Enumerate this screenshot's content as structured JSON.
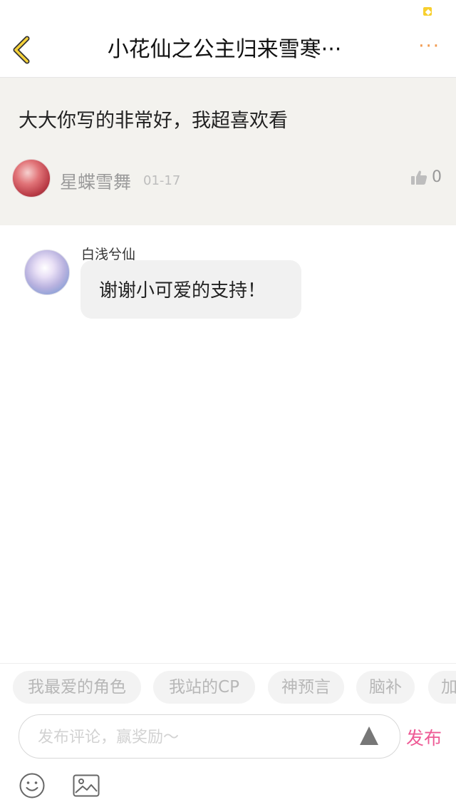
{
  "header": {
    "title": "小花仙之公主归来雪寒···",
    "back_icon": "chevron-left-icon",
    "more_label": "···",
    "accent_color": "#f7cf2e"
  },
  "post": {
    "text": "大大你写的非常好，我超喜欢看",
    "username": "星蝶雪舞",
    "date": "01-17",
    "like_count": "0"
  },
  "reply": {
    "username": "白浅兮仙",
    "text": "谢谢小可爱的支持！"
  },
  "tags": [
    "我最爱的角色",
    "我站的CP",
    "神预言",
    "脑补",
    "加"
  ],
  "composer": {
    "placeholder": "发布评论，赢奖励～",
    "publish_label": "发布",
    "publish_color": "#ee5a95"
  }
}
